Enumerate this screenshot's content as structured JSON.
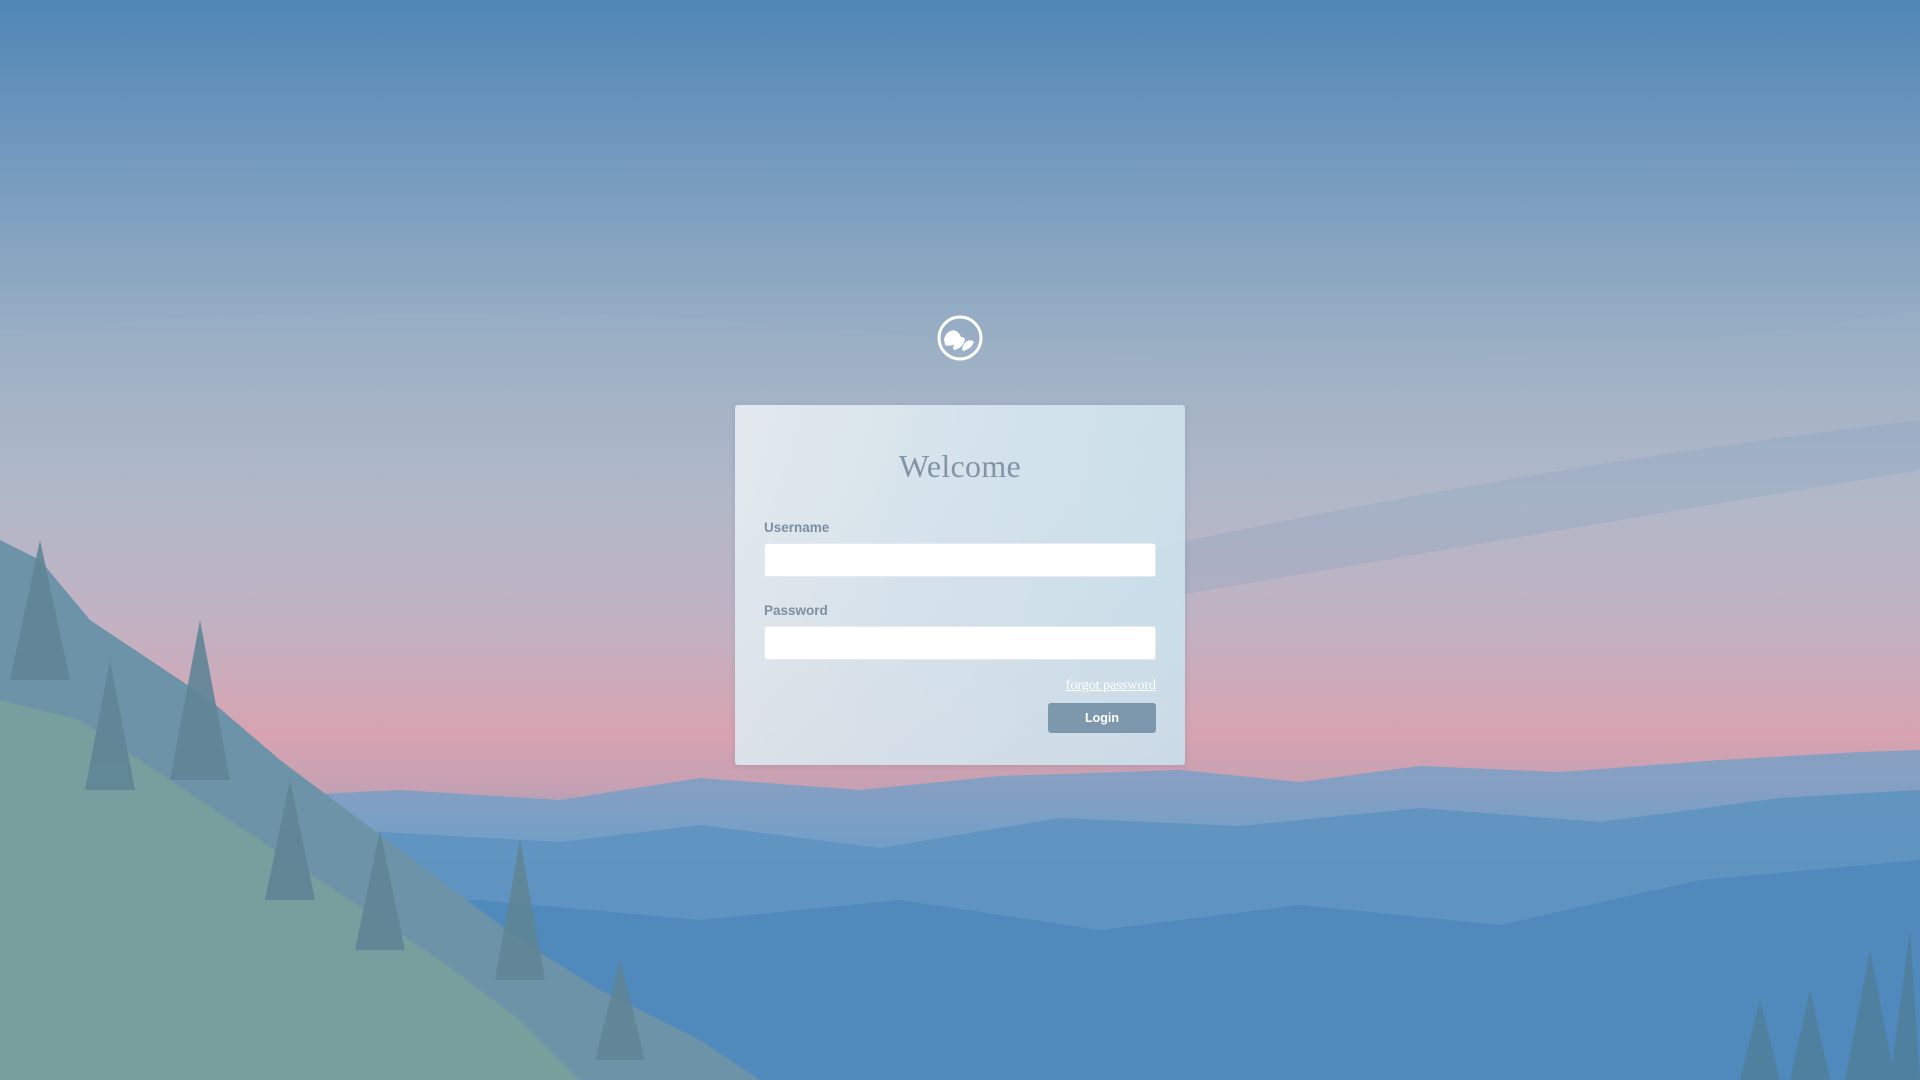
{
  "login_card": {
    "title": "Welcome",
    "username_label": "Username",
    "username_value": "",
    "password_label": "Password",
    "password_value": "",
    "forgot_password_link": "forgot password",
    "login_button": "Login"
  },
  "logo": {
    "icon": "leaf-circle-logo-icon"
  },
  "colors": {
    "title_text": "#8294a6",
    "label_text": "#7c8fa0",
    "button_bg": "#7d97ad",
    "link_text": "#ffffff"
  },
  "background": {
    "description_icon": "mountain-landscape-background"
  }
}
